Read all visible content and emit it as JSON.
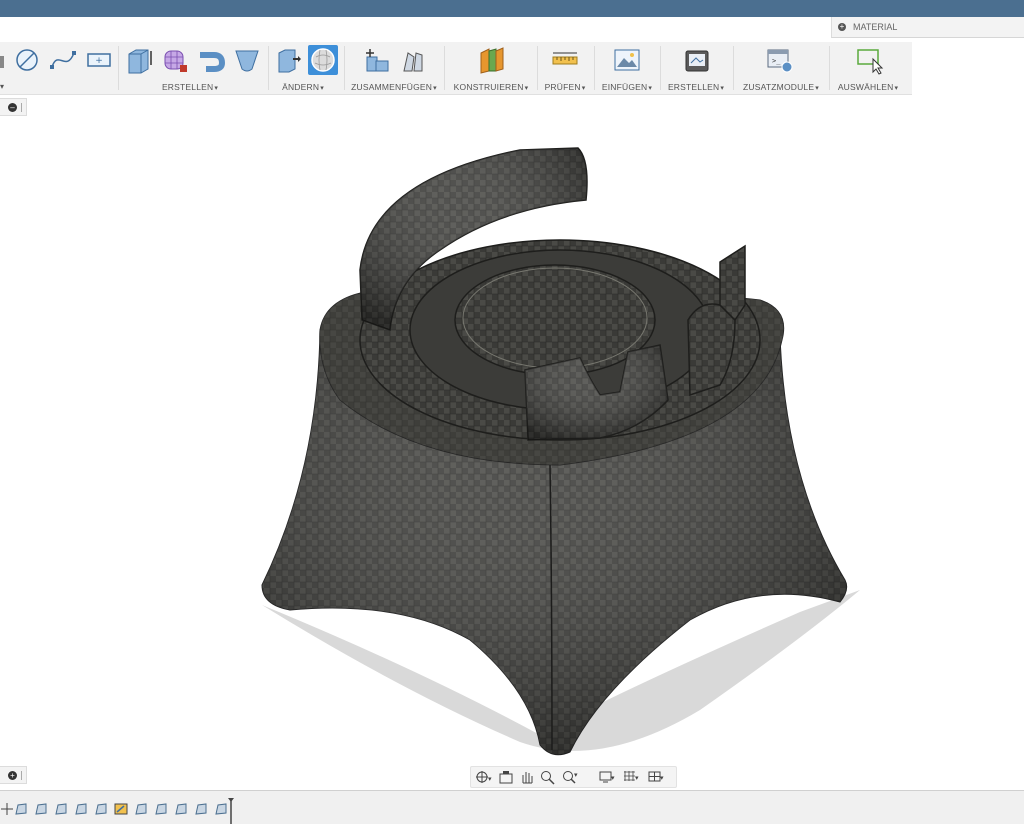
{
  "material_panel": {
    "label": "MATERIAL"
  },
  "toolbar": {
    "groups": [
      {
        "label": "ERSTELLEN"
      },
      {
        "label": "ÄNDERN"
      },
      {
        "label": "ZUSAMMENFÜGEN"
      },
      {
        "label": "KONSTRUIEREN"
      },
      {
        "label": "PRÜFEN"
      },
      {
        "label": "EINFÜGEN"
      },
      {
        "label": "ERSTELLEN"
      },
      {
        "label": "ZUSATZMODULE"
      },
      {
        "label": "AUSWÄHLEN"
      }
    ],
    "caret": "▾",
    "icons": [
      "finish-sketch-icon",
      "circle-sketch-icon",
      "spline-sketch-icon",
      "rectangle-sketch-icon",
      "box-icon",
      "tsplines-box-icon",
      "pipe-icon",
      "face-icon",
      "edit-form-icon",
      "sphere-form-icon",
      "joint-icon",
      "as-built-joint-icon",
      "construct-plane-icon",
      "measure-icon",
      "insert-image-icon",
      "render-icon",
      "scripts-addins-icon",
      "select-window-icon"
    ]
  },
  "viewport": {
    "model": "3d-model-stand",
    "texture": "dark-woven-material"
  },
  "navbar": {
    "icons": [
      "orbit-icon",
      "look-at-icon",
      "pan-icon",
      "zoom-icon",
      "fit-icon",
      "display-settings-icon",
      "grid-icon",
      "viewports-icon"
    ]
  },
  "timeline": {
    "icons": [
      "move-timeline-icon",
      "feature-icon",
      "feature-icon",
      "feature-icon",
      "feature-icon",
      "feature-icon",
      "sketch-feature-icon",
      "feature-icon",
      "feature-icon",
      "feature-icon",
      "feature-icon",
      "feature-icon",
      "timeline-marker-icon"
    ]
  },
  "colors": {
    "titlebar": "#4b6f90",
    "toolbar": "#f2f2f2",
    "active": "#3d8fd9",
    "model": "#3a3a37",
    "shadow": "#d9d9d9"
  }
}
